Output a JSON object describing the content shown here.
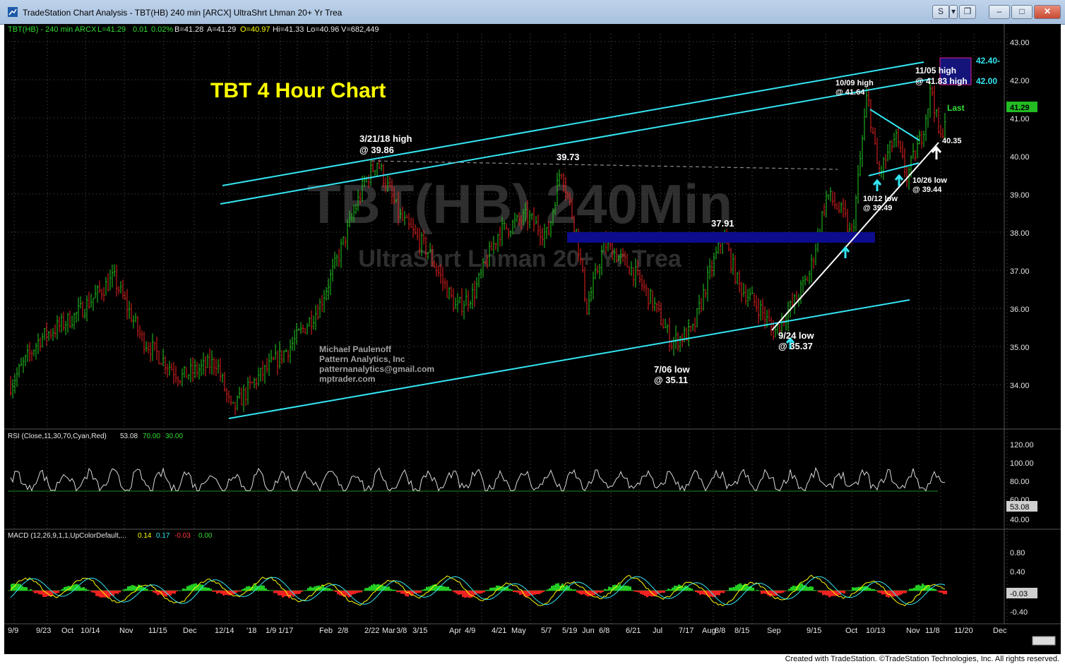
{
  "window": {
    "title": "TradeStation Chart Analysis - TBT(HB) 240 min [ARCX] UltraShrt Lhman 20+ Yr Trea",
    "buttons": {
      "share": "S",
      "dropdown": "▾",
      "detach": "❐",
      "minimize": "–",
      "maximize": "□",
      "close": "✕"
    }
  },
  "header": {
    "symbol_info": "TBT(HB) - 240 min ARCX",
    "L": "L=41.29",
    "chg": "0.01",
    "pct": "0.02%",
    "B": "B=41.28",
    "A": "A=41.29",
    "O": "O=40.97",
    "Hi": "Hi=41.33",
    "Lo": "Lo=40.96",
    "V": "V=682,449"
  },
  "watermark": {
    "line1": "TBT(HB) 240Min",
    "line2": "UltraShrt Lhman 20+ Yr Trea"
  },
  "chart_title": "TBT 4 Hour Chart",
  "author": {
    "name": "Michael Paulenoff",
    "company": "Pattern Analytics, Inc",
    "email": "patternanalytics@gmail.com",
    "site": "mptrader.com"
  },
  "annotations": {
    "a1": "3/21/18 high",
    "a1b": "@ 39.86",
    "a2": "39.73",
    "a3": "37.91",
    "a4": "7/06 low",
    "a4b": "@ 35.11",
    "a5": "9/24 low",
    "a5b": "@ 35.37",
    "a6": "10/09 high",
    "a6b": "@ 41.64",
    "a7": "11/05 high",
    "a7b": "@ 41.83 high",
    "a8": "10/12 low",
    "a8b": "@ 39.49",
    "a9": "10/26 low",
    "a9b": "@ 39.44",
    "a10": "40.35",
    "a11": "42.40-",
    "a12": "42.00",
    "last": "Last"
  },
  "price_axis": {
    "ticks": [
      "43.00",
      "42.00",
      "41.00",
      "40.00",
      "39.00",
      "38.00",
      "37.00",
      "36.00",
      "35.00",
      "34.00"
    ],
    "last": "41.29"
  },
  "rsi": {
    "label": "RSI (Close,11,30,70,Cyan,Red)",
    "v1": "53.08",
    "v2": "70.00",
    "v3": "30.00",
    "ticks": [
      "120.00",
      "100.00",
      "80.00",
      "60.00",
      "40.00"
    ],
    "last": "53.08"
  },
  "macd": {
    "label": "MACD (12,26,9,1,1,UpColorDefault,...",
    "v1": "0.14",
    "v2": "0.17",
    "v3": "-0.03",
    "v4": "0.00",
    "ticks": [
      "0.80",
      "0.40",
      "-0.40"
    ],
    "last": "-0.03"
  },
  "time_axis": [
    "9/9",
    "9/23",
    "Oct",
    "10/14",
    "Nov",
    "11/15",
    "Dec",
    "12/14",
    "'18",
    "1/9",
    "1/17",
    "Feb",
    "2/8",
    "2/22",
    "Mar",
    "3/8",
    "3/15",
    "Apr",
    "4/9",
    "4/21",
    "May",
    "5/7",
    "5/19",
    "Jun",
    "6/8",
    "6/21",
    "Jul",
    "7/17",
    "Aug",
    "8/8",
    "8/15",
    "Sep",
    "9/15",
    "Oct",
    "10/13",
    "Nov",
    "11/8",
    "11/20",
    "Dec"
  ],
  "chart_data": {
    "type": "candlestick",
    "symbol": "TBT(HB)",
    "interval": "240 min",
    "ylim": [
      33.2,
      43.2
    ],
    "last": 41.29,
    "anchors": [
      [
        9,
        34.0
      ],
      [
        50,
        35.2
      ],
      [
        100,
        35.8
      ],
      [
        155,
        36.8
      ],
      [
        195,
        35.2
      ],
      [
        250,
        34.2
      ],
      [
        300,
        34.6
      ],
      [
        322,
        33.3
      ],
      [
        355,
        34.1
      ],
      [
        405,
        35.0
      ],
      [
        445,
        36.0
      ],
      [
        470,
        37.2
      ],
      [
        510,
        39.3
      ],
      [
        528,
        39.86
      ],
      [
        560,
        38.4
      ],
      [
        600,
        37.5
      ],
      [
        640,
        36.0
      ],
      [
        665,
        36.4
      ],
      [
        700,
        38.0
      ],
      [
        740,
        38.4
      ],
      [
        770,
        37.9
      ],
      [
        788,
        39.73
      ],
      [
        810,
        38.0
      ],
      [
        825,
        36.0
      ],
      [
        850,
        37.7
      ],
      [
        890,
        37.0
      ],
      [
        920,
        36.1
      ],
      [
        945,
        35.11
      ],
      [
        975,
        35.4
      ],
      [
        995,
        36.7
      ],
      [
        1018,
        37.91
      ],
      [
        1040,
        36.6
      ],
      [
        1070,
        36.0
      ],
      [
        1090,
        35.37
      ],
      [
        1120,
        36.2
      ],
      [
        1140,
        36.9
      ],
      [
        1165,
        39.0
      ],
      [
        1190,
        38.4
      ],
      [
        1200,
        37.8
      ],
      [
        1222,
        41.64
      ],
      [
        1238,
        39.49
      ],
      [
        1262,
        40.5
      ],
      [
        1278,
        39.44
      ],
      [
        1300,
        40.6
      ],
      [
        1313,
        41.83
      ],
      [
        1325,
        40.35
      ],
      [
        1335,
        41.29
      ]
    ]
  }
}
